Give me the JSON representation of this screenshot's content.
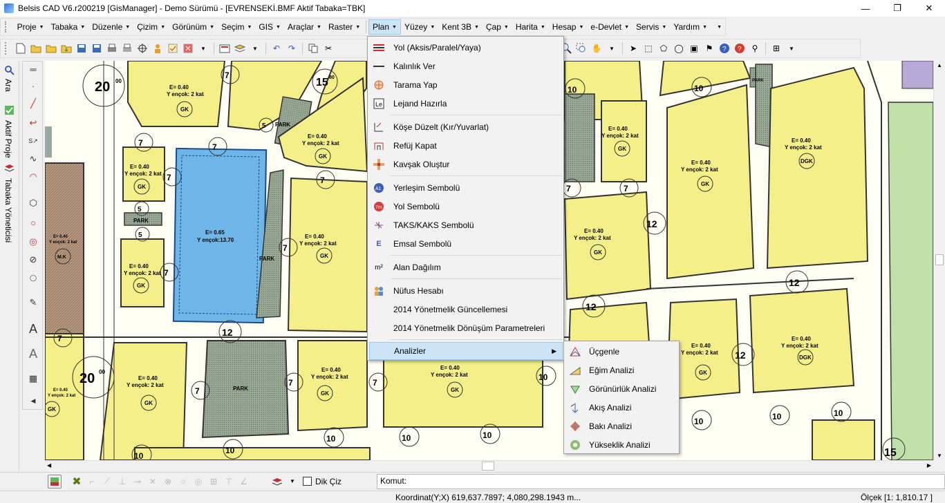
{
  "window": {
    "title": "Belsis CAD V6.r200219 [GisManager] - Demo Sürümü - [EVRENSEKİ.BMF  Aktif Tabaka=TBK]",
    "minimize": "—",
    "maximize": "❐",
    "close": "✕"
  },
  "menubar": {
    "items": [
      {
        "label": "Proje"
      },
      {
        "label": "Tabaka"
      },
      {
        "label": "Düzenle"
      },
      {
        "label": "Çizim"
      },
      {
        "label": "Görünüm"
      },
      {
        "label": "Seçim"
      },
      {
        "label": "GIS"
      },
      {
        "label": "Araçlar"
      },
      {
        "label": "Raster"
      },
      {
        "label": "Plan"
      },
      {
        "label": "Yüzey"
      },
      {
        "label": "Kent 3B"
      },
      {
        "label": "Çap"
      },
      {
        "label": "Harita"
      },
      {
        "label": "Hesap"
      },
      {
        "label": "e-Devlet"
      },
      {
        "label": "Servis"
      },
      {
        "label": "Yardım"
      }
    ],
    "active": "Plan"
  },
  "leftpanel": {
    "tabs": [
      "Ara",
      "Aktif Proje",
      "Tabaka Yöneticisi"
    ]
  },
  "plan_menu": {
    "items": [
      {
        "label": "Yol (Aksis/Paralel/Yaya)",
        "icon": "road-icon"
      },
      {
        "label": "Kalınlık Ver",
        "icon": "line-thickness-icon"
      },
      {
        "label": "Tarama Yap",
        "icon": "hatch-icon"
      },
      {
        "label": "Lejand Hazırla",
        "icon": "legend-icon"
      },
      {
        "label": "Köşe Düzelt (Kır/Yuvarlat)",
        "icon": "corner-icon"
      },
      {
        "label": "Refüj Kapat",
        "icon": "refuge-icon"
      },
      {
        "label": "Kavşak Oluştur",
        "icon": "junction-icon"
      },
      {
        "label": "Yerleşim Sembolü",
        "icon": "settlement-symbol-icon"
      },
      {
        "label": "Yol Sembolü",
        "icon": "road-symbol-icon"
      },
      {
        "label": "TAKS/KAKS Sembolü",
        "icon": "taks-kaks-icon"
      },
      {
        "label": "Emsal Sembolü",
        "icon": "emsal-icon"
      },
      {
        "label": "Alan Dağılım",
        "icon": "area-distribution-icon"
      },
      {
        "label": "Nüfus Hesabı",
        "icon": "population-icon"
      },
      {
        "label": "2014 Yönetmelik Güncellemesi",
        "icon": ""
      },
      {
        "label": "2014 Yönetmelik Dönüşüm Parametreleri",
        "icon": ""
      },
      {
        "label": "Analizler",
        "icon": ""
      }
    ],
    "highlighted": "Analizler"
  },
  "analysis_submenu": {
    "items": [
      {
        "label": "Üçgenle",
        "icon": "triangulate-icon"
      },
      {
        "label": "Eğim Analizi",
        "icon": "slope-icon"
      },
      {
        "label": "Görünürlük Analizi",
        "icon": "visibility-icon"
      },
      {
        "label": "Akış Analizi",
        "icon": "flow-icon"
      },
      {
        "label": "Bakı Analizi",
        "icon": "aspect-icon"
      },
      {
        "label": "Yükseklik Analizi",
        "icon": "elevation-icon"
      }
    ]
  },
  "bottom": {
    "dik_ciz": "Dik Çiz",
    "komut_label": "Komut:",
    "coordinate": "Koordinat(Y;X)  619,637.7897; 4,080,298.1943 m...",
    "scale": "Ölçek [1: 1,810.17 ]"
  },
  "map": {
    "labels": {
      "e040": "E= 0.40",
      "yencok2": "Y ençok: 2 kat",
      "gk": "GK",
      "dgk": "DGK",
      "park": "PARK",
      "mk": "M.K",
      "e065": "E= 0.65",
      "yencok1370": "Y ençok:13.70",
      "r20": "20",
      "r15": "15",
      "r12": "12",
      "r10": "10",
      "r7": "7",
      "r5": "5",
      "sup": "00",
      "sup80": "80"
    }
  },
  "colors": {
    "parcel_yellow": "#f5ef8a",
    "road": "#ffffff",
    "park_green": "#8fa38a",
    "selected_blue": "#6fb6e8",
    "brown_hatch": "#b89a82",
    "lavender": "#b9a9d6",
    "green_strip": "#bfe0a8",
    "menu_highlight": "#cce4f7"
  }
}
